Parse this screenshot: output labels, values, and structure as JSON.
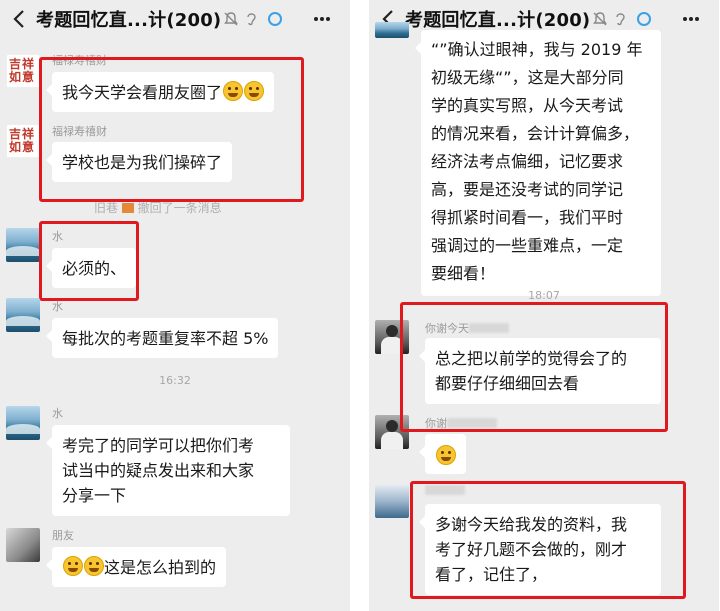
{
  "left": {
    "title": "考题回忆直...计(200)",
    "messages": [
      {
        "sender": "福禄寿禧财",
        "text": "我今天学会看朋友圈了"
      },
      {
        "sender": "福禄寿禧财",
        "text": "学校也是为我们操碎了"
      },
      {
        "sender": "水",
        "text": "必须的、"
      },
      {
        "sender": "水",
        "text": "每批次的考题重复率不超 5%"
      },
      {
        "sender": "水",
        "lines": [
          "考完了的同学可以把你们考",
          "试当中的疑点发出来和大家",
          "分享一下"
        ]
      },
      {
        "sender": "朋友",
        "text": "这是怎么拍到的"
      }
    ],
    "recall_prefix": "旧巷",
    "recall_text": "撤回了一条消息",
    "time": "16:32",
    "avatar_text": [
      "吉祥",
      "如意"
    ]
  },
  "right": {
    "title": "考题回忆直...计(200)",
    "long_lines": [
      "“”确认过眼神，我与 2019 年",
      "初级无缘“”，这是大部分同",
      "学的真实写照，从今天考试",
      "的情况来看，会计计算偏多，",
      "经济法考点偏细，记忆要求",
      "高，要是还没考试的同学记",
      "得抓紧时间看一，我们平时",
      "强调过的一些重难点，一定",
      "要细看！"
    ],
    "time": "18:07",
    "messages": [
      {
        "sender": "你谢今天",
        "lines": [
          "总之把以前学的觉得会了的",
          "都要仔仔细细回去看"
        ]
      },
      {
        "sender": "你谢",
        "text": ""
      },
      {
        "sender": "",
        "lines": [
          "多谢今天给我发的资料，我",
          "考了好几题不会做的，刚才",
          "看了，记住了，"
        ]
      }
    ]
  },
  "colors": {
    "highlight": "#e0191e",
    "bubble": "#ffffff",
    "background": "#ededed"
  }
}
